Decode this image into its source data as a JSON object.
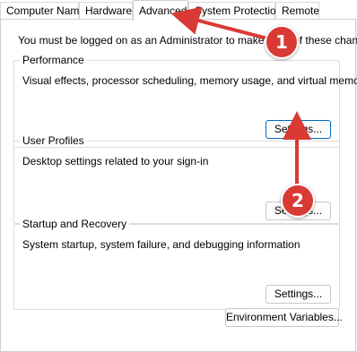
{
  "tabs": [
    {
      "label": "Computer Name"
    },
    {
      "label": "Hardware"
    },
    {
      "label": "Advanced"
    },
    {
      "label": "System Protection"
    },
    {
      "label": "Remote"
    }
  ],
  "active_tab": "Advanced",
  "admin_notice": "You must be logged on as an Administrator to make most of these changes.",
  "performance": {
    "title": "Performance",
    "description": "Visual effects, processor scheduling, memory usage, and virtual memory",
    "button": "Settings..."
  },
  "user_profiles": {
    "title": "User Profiles",
    "description": "Desktop settings related to your sign-in",
    "button": "Settings..."
  },
  "startup_recovery": {
    "title": "Startup and Recovery",
    "description": "System startup, system failure, and debugging information",
    "button": "Settings..."
  },
  "environment_button": "Environment Variables...",
  "annotations": {
    "step1": "1",
    "step2": "2",
    "color": "#d93a35"
  }
}
